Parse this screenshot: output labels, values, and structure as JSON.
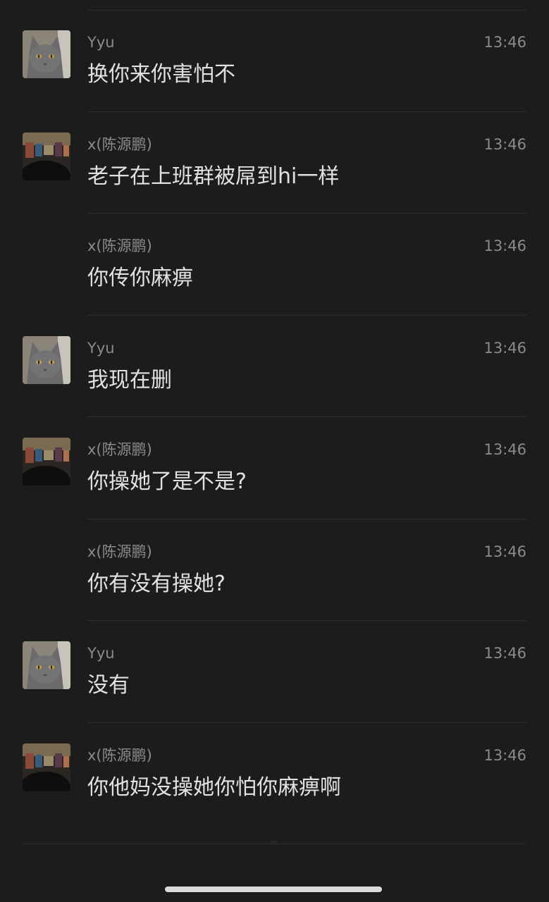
{
  "messages": [
    {
      "sender": "Yyu",
      "time": "13:46",
      "text": "换你来你害怕不",
      "avatar": "cat-avatar"
    },
    {
      "sender": "x(陈源鹏)",
      "time": "13:46",
      "text": "老子在上班群被屌到hi一样",
      "avatar": "room-photo-avatar"
    },
    {
      "sender": "x(陈源鹏)",
      "time": "13:46",
      "text": "你传你麻痹",
      "avatar": ""
    },
    {
      "sender": "Yyu",
      "time": "13:46",
      "text": "我现在删",
      "avatar": "cat-avatar"
    },
    {
      "sender": "x(陈源鹏)",
      "time": "13:46",
      "text": "你操她了是不是?",
      "avatar": "room-photo-avatar"
    },
    {
      "sender": "x(陈源鹏)",
      "time": "13:46",
      "text": "你有没有操她?",
      "avatar": ""
    },
    {
      "sender": "Yyu",
      "time": "13:46",
      "text": "没有",
      "avatar": "cat-avatar"
    },
    {
      "sender": "x(陈源鹏)",
      "time": "13:46",
      "text": "你他妈没操她你怕你麻痹啊",
      "avatar": "room-photo-avatar"
    }
  ],
  "colors": {
    "background": "#1c1c1c",
    "sender_text": "#8b8b8b",
    "message_text": "#e1e1e1",
    "divider": "#2c2c2c"
  }
}
